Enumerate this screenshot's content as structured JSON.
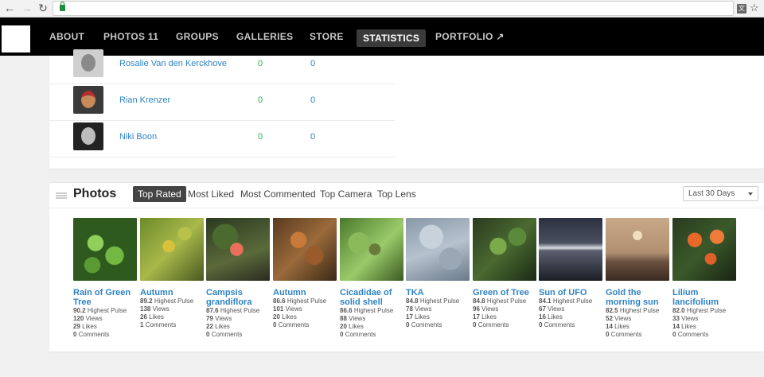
{
  "browser": {
    "back_icon": "back-arrow-icon",
    "forward_icon": "forward-arrow-icon",
    "reload_icon": "reload-icon",
    "star_icon": "star-icon",
    "translate_icon": "translate-icon"
  },
  "topnav": {
    "items": [
      {
        "label": "ABOUT",
        "active": false
      },
      {
        "label": "PHOTOS 11",
        "active": false
      },
      {
        "label": "GROUPS",
        "active": false
      },
      {
        "label": "GALLERIES",
        "active": false
      },
      {
        "label": "STORE",
        "active": false
      },
      {
        "label": "STATISTICS",
        "active": true
      },
      {
        "label": "PORTFOLIO ↗",
        "active": false
      }
    ]
  },
  "people": [
    {
      "name": "Rosalie Van den Kerckhove",
      "col1": "0",
      "col2": "0"
    },
    {
      "name": "Rian Krenzer",
      "col1": "0",
      "col2": "0"
    },
    {
      "name": "Niki Boon",
      "col1": "0",
      "col2": "0"
    }
  ],
  "photos_section": {
    "title": "Photos",
    "tabs": [
      "Top Rated",
      "Most Liked",
      "Most Commented",
      "Top Camera",
      "Top Lens"
    ],
    "active_tab": "Top Rated",
    "range": "Last 30 Days",
    "labels": {
      "pulse": "Highest Pulse",
      "views": "Views",
      "likes": "Likes",
      "comments": "Comments"
    },
    "items": [
      {
        "title": "Rain of Green Tree",
        "pulse": "90.2",
        "views": "120",
        "likes": "29",
        "comments": "0"
      },
      {
        "title": "Autumn",
        "pulse": "89.2",
        "views": "138",
        "likes": "26",
        "comments": "1"
      },
      {
        "title": "Campsis grandiflora",
        "pulse": "87.6",
        "views": "79",
        "likes": "22",
        "comments": "0"
      },
      {
        "title": "Autumn",
        "pulse": "86.6",
        "views": "101",
        "likes": "20",
        "comments": "0"
      },
      {
        "title": "Cicadidae of solid shell",
        "pulse": "86.6",
        "views": "88",
        "likes": "20",
        "comments": "0"
      },
      {
        "title": "TKA",
        "pulse": "84.8",
        "views": "78",
        "likes": "17",
        "comments": "0"
      },
      {
        "title": "Green of Tree",
        "pulse": "84.8",
        "views": "96",
        "likes": "17",
        "comments": "0"
      },
      {
        "title": "Sun of UFO",
        "pulse": "84.1",
        "views": "67",
        "likes": "16",
        "comments": "0"
      },
      {
        "title": "Gold the morning sun",
        "pulse": "82.5",
        "views": "52",
        "likes": "14",
        "comments": "0"
      },
      {
        "title": "Lilium lancifolium",
        "pulse": "82.0",
        "views": "33",
        "likes": "14",
        "comments": "0"
      }
    ]
  }
}
